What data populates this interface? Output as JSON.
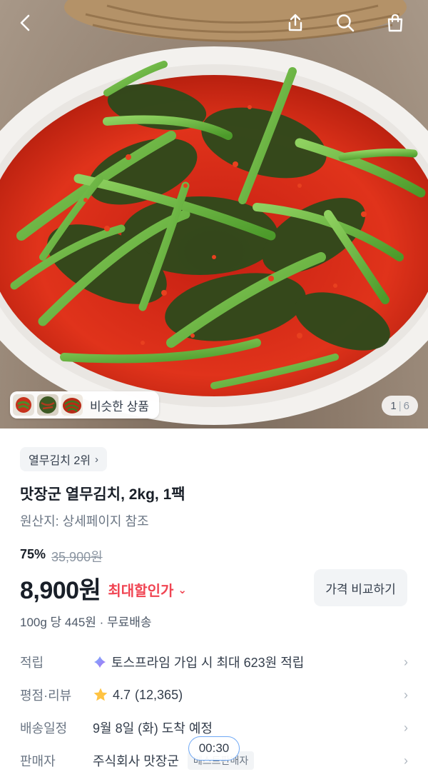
{
  "header": {
    "back_icon": "back-arrow-icon",
    "share_icon": "share-icon",
    "search_icon": "search-icon",
    "cart_icon": "shopping-bag-icon"
  },
  "gallery": {
    "similar_label": "비슷한 상품",
    "current_page": "1",
    "page_separator": "|",
    "total_pages": "6"
  },
  "product": {
    "rank_label": "열무김치 2위",
    "title": "맛장군 열무김치, 2kg, 1팩",
    "origin": "원산지: 상세페이지 참조",
    "discount_rate": "75%",
    "original_price": "35,900원",
    "price": "8,900원",
    "max_discount_label": "최대할인가",
    "compare_button": "가격 비교하기",
    "unit_price": "100g 당 445원 · 무료배송"
  },
  "details": [
    {
      "key": "적립",
      "value": "토스프라임 가입 시 최대 623원 적립"
    },
    {
      "key": "평점·리뷰",
      "rating": "4.7",
      "count": "(12,365)"
    },
    {
      "key": "배송일정",
      "value": "9월 8일 (화) 도착 예정"
    },
    {
      "key": "판매자",
      "value": "주식회사 맛장군",
      "tag": "베스트판매자"
    }
  ],
  "overlay": {
    "timer": "00:30"
  },
  "colors": {
    "accent_red": "#f04452",
    "text_primary": "#191f28",
    "text_secondary": "#6b7684",
    "chip_bg": "#f2f4f6",
    "star": "#ffc342"
  }
}
